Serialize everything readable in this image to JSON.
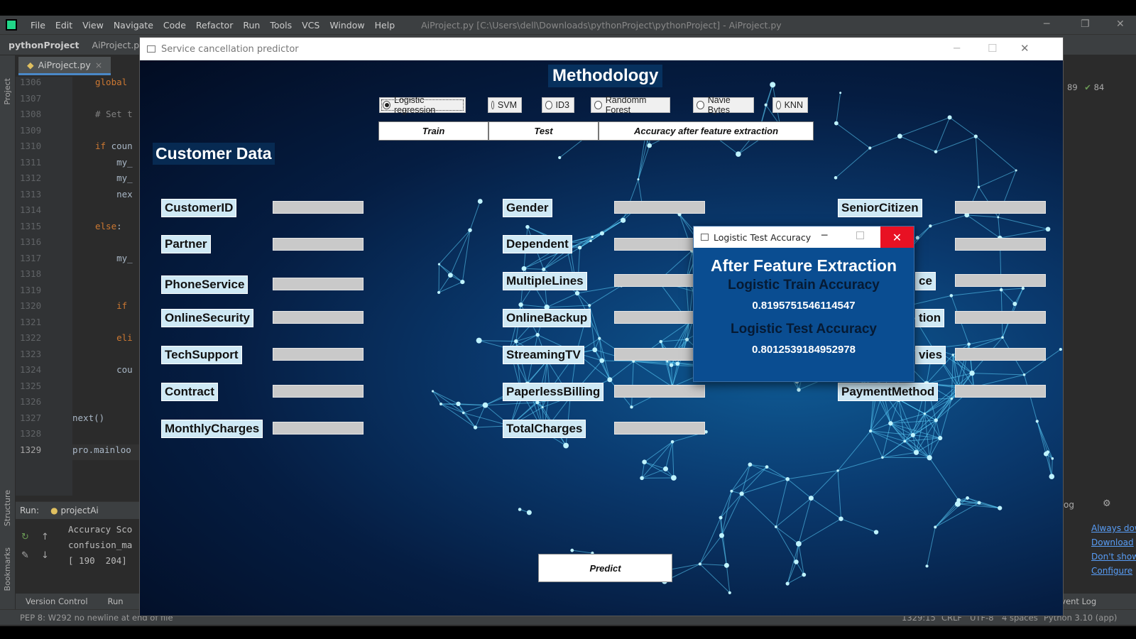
{
  "ide": {
    "menu": [
      "File",
      "Edit",
      "View",
      "Navigate",
      "Code",
      "Refactor",
      "Run",
      "Tools",
      "VCS",
      "Window",
      "Help"
    ],
    "window_title": "AiProject.py [C:\\Users\\dell\\Downloads\\pythonProject\\pythonProject] - AiProject.py",
    "breadcrumb": [
      "pythonProject",
      "AiProject.py"
    ],
    "file_tab": "AiProject.py",
    "left_labels": {
      "project": "Project",
      "structure": "Structure",
      "bookmarks": "Bookmarks"
    },
    "line_numbers": [
      "1306",
      "1307",
      "1308",
      "1309",
      "1310",
      "1311",
      "1312",
      "1313",
      "1314",
      "1315",
      "1316",
      "1317",
      "1318",
      "1319",
      "1320",
      "1321",
      "1322",
      "1323",
      "1324",
      "1325",
      "1326",
      "1327",
      "1328",
      "1329"
    ],
    "code_lines": [
      {
        "kw": "global",
        "text": ""
      },
      {
        "kw": "",
        "text": ""
      },
      {
        "cm": "# Set t"
      },
      {
        "kw": "",
        "text": ""
      },
      {
        "kw": "if",
        "text": " coun"
      },
      {
        "kw": "",
        "text": "    my_"
      },
      {
        "kw": "",
        "text": "    my_"
      },
      {
        "kw": "",
        "text": "    nex"
      },
      {
        "kw": "",
        "text": ""
      },
      {
        "kw": "else",
        "text": ":"
      },
      {
        "kw": "",
        "text": ""
      },
      {
        "kw": "",
        "text": "    my_"
      },
      {
        "kw": "",
        "text": ""
      },
      {
        "kw": "",
        "text": ""
      },
      {
        "kw": "    if",
        "text": ""
      },
      {
        "kw": "",
        "text": ""
      },
      {
        "kw": "    eli",
        "text": ""
      },
      {
        "kw": "",
        "text": ""
      },
      {
        "kw": "",
        "text": "    cou"
      },
      {
        "kw": "",
        "text": ""
      },
      {
        "kw": "",
        "text": ""
      },
      {
        "kw": "",
        "text": "next()"
      },
      {
        "kw": "",
        "text": ""
      },
      {
        "kw": "",
        "text": "pro.mainloo"
      }
    ],
    "right_counts": {
      "warnings": "89",
      "ok": "84"
    },
    "run": {
      "label": "Run:",
      "config": "projectAi",
      "output": [
        "Accuracy Sco",
        "confusion_ma",
        "[ 190  204]"
      ]
    },
    "bottom_tabs": {
      "version_control": "Version Control",
      "run": "Run",
      "event_log": "Event Log",
      "log_fragment": "og"
    },
    "status": {
      "message": "PEP 8: W292 no newline at end of file",
      "position": "1329:15",
      "line_sep": "CRLF",
      "encoding": "UTF-8",
      "indent": "4 spaces",
      "interpreter": "Python 3.10 (app)"
    },
    "event_links": [
      "Always dow",
      "Download",
      "Don't show",
      "Configure"
    ]
  },
  "app": {
    "title": "Service cancellation predictor",
    "methodology_title": "Methodology",
    "algorithms": [
      {
        "label": "Logistic regression",
        "selected": true
      },
      {
        "label": "SVM",
        "selected": false
      },
      {
        "label": "ID3",
        "selected": false
      },
      {
        "label": "Randomm Forest",
        "selected": false
      },
      {
        "label": "Navie Bytes",
        "selected": false
      },
      {
        "label": "KNN",
        "selected": false
      }
    ],
    "buttons": {
      "train": "Train",
      "test": "Test",
      "accuracy_after_fe": "Accuracy after feature extraction",
      "predict": "Predict"
    },
    "section_title": "Customer Data",
    "fields": {
      "col1": [
        "CustomerID",
        "Partner",
        "PhoneService",
        "OnlineSecurity",
        "TechSupport",
        "Contract",
        "MonthlyCharges"
      ],
      "col2": [
        "Gender",
        "Dependent",
        "MultipleLines",
        "OnlineBackup",
        "StreamingTV",
        "PaperlessBilling",
        "TotalCharges"
      ],
      "col3": [
        "SeniorCitizen",
        "",
        "ce",
        "tion",
        "vies",
        "PaymentMethod"
      ]
    }
  },
  "popup": {
    "title": "Logistic Test Accuracy",
    "heading": "After Feature Extraction",
    "train_label": "Logistic Train Accuracy",
    "train_value": "0.8195751546114547",
    "test_label": "Logistic Test Accuracy",
    "test_value": "0.8012539184952978"
  }
}
